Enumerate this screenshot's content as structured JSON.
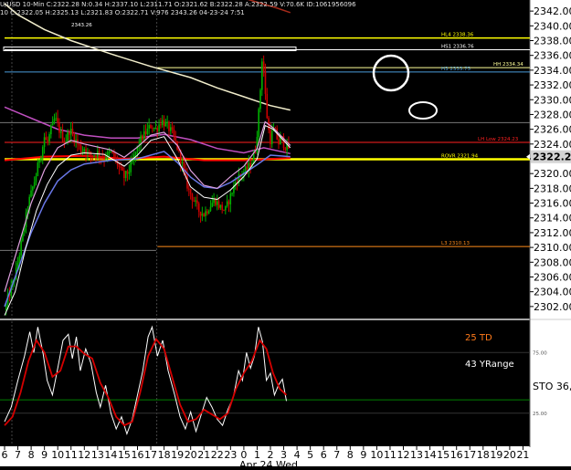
{
  "header": {
    "line1": "U/USD 10-Min  C:2322.28 N:0.34 H:2337.10 L:2311.71 O:2321.62 B:2322.28 A:2322.59 V:70.6K  ID:1061956096",
    "line2": "10 C:2322.05 H:2325.13 L:2321.83 O:2322.71 V:976 2343.26 04-23-24 7:51"
  },
  "colors": {
    "background": "#000000",
    "axis_panel": "#ffffff",
    "price_box": "#d4d4d4",
    "up_candle": "#00b000",
    "down_candle": "#cc0000",
    "bright_yellow": "#ffff00",
    "red": "#ff0000",
    "cream_ma": "#f2eecc",
    "sto_white": "#ffffff",
    "sto_red": "#d40000"
  },
  "chart_data": [
    {
      "type": "candlestick",
      "title": "",
      "ylim": [
        2300.5,
        2343.5
      ],
      "y_ticks": [
        "2302.00",
        "2304.00",
        "2306.00",
        "2308.00",
        "2310.00",
        "2312.00",
        "2314.00",
        "2316.00",
        "2318.00",
        "2320.00",
        "2322.00",
        "2324.00",
        "2326.00",
        "2328.00",
        "2330.00",
        "2332.00",
        "2334.00",
        "2336.00",
        "2338.00",
        "2340.00",
        "2342.00"
      ],
      "last_price": "2322.28",
      "high_label": "2343.26",
      "levels": [
        {
          "label": "HL4 2338.36",
          "value": 2338.36,
          "color": "#ffff00"
        },
        {
          "label": "HS1 2336.76",
          "value": 2336.76,
          "color": "#ffffff"
        },
        {
          "label": "HH 2334.34",
          "value": 2334.34,
          "color": "#ffff99"
        },
        {
          "label": "H3 2333.75",
          "value": 2333.75,
          "color": "#4a9bd8"
        },
        {
          "label": "LH Low 2324.23",
          "value": 2324.23,
          "color": "#ff2020"
        },
        {
          "label": "ROVR 2321.94",
          "value": 2321.94,
          "color": "#ffff00"
        },
        {
          "label": "L3 2310.13",
          "value": 2310.13,
          "color": "#ff8c1a"
        }
      ],
      "price_path": [
        [
          0,
          2301.5
        ],
        [
          0.1,
          2302
        ],
        [
          0.3,
          2303.5
        ],
        [
          0.6,
          2305
        ],
        [
          0.9,
          2307
        ],
        [
          1.2,
          2310
        ],
        [
          1.5,
          2313
        ],
        [
          1.8,
          2316
        ],
        [
          2.1,
          2318
        ],
        [
          2.4,
          2320
        ],
        [
          2.6,
          2322
        ],
        [
          2.8,
          2323
        ],
        [
          3.0,
          2325
        ],
        [
          3.2,
          2324
        ],
        [
          3.5,
          2326
        ],
        [
          3.8,
          2327.5
        ],
        [
          4.0,
          2326.5
        ],
        [
          4.3,
          2325
        ],
        [
          4.6,
          2324.5
        ],
        [
          4.9,
          2326
        ],
        [
          5.2,
          2325
        ],
        [
          5.5,
          2324
        ],
        [
          5.8,
          2323
        ],
        [
          6.0,
          2323.5
        ],
        [
          6.3,
          2322.5
        ],
        [
          6.6,
          2322.5
        ],
        [
          7.0,
          2322.8
        ],
        [
          7.4,
          2322.2
        ],
        [
          8.0,
          2322.8
        ],
        [
          8.3,
          2322
        ],
        [
          8.7,
          2320.5
        ],
        [
          9.0,
          2319.5
        ],
        [
          9.4,
          2320.5
        ],
        [
          9.8,
          2322.5
        ],
        [
          10.2,
          2324.5
        ],
        [
          10.6,
          2325.5
        ],
        [
          11.0,
          2326.5
        ],
        [
          11.4,
          2326
        ],
        [
          11.8,
          2327.2
        ],
        [
          12.2,
          2326.5
        ],
        [
          12.6,
          2325.5
        ],
        [
          13.0,
          2323.5
        ],
        [
          13.4,
          2321
        ],
        [
          13.8,
          2318
        ],
        [
          14.2,
          2316.5
        ],
        [
          14.6,
          2315
        ],
        [
          15.0,
          2314.5
        ],
        [
          15.4,
          2315.5
        ],
        [
          15.8,
          2316.5
        ],
        [
          16.2,
          2315.5
        ],
        [
          16.6,
          2315
        ],
        [
          17.0,
          2317
        ],
        [
          17.4,
          2319
        ],
        [
          17.8,
          2320
        ],
        [
          18.2,
          2320.5
        ],
        [
          18.6,
          2321.5
        ],
        [
          18.9,
          2323.5
        ],
        [
          19.2,
          2330
        ],
        [
          19.4,
          2336.5
        ],
        [
          19.6,
          2331
        ],
        [
          19.8,
          2326.5
        ],
        [
          20.0,
          2324.5
        ],
        [
          20.2,
          2326
        ],
        [
          20.4,
          2325.5
        ],
        [
          20.6,
          2324
        ],
        [
          20.8,
          2325
        ],
        [
          21.0,
          2324
        ],
        [
          21.2,
          2323.5
        ],
        [
          21.4,
          2323.5
        ]
      ]
    },
    {
      "type": "line",
      "title": "",
      "ylim": [
        0,
        100
      ],
      "labels": {
        "td": "25 TD",
        "yrange": "43 YRange",
        "sto": "STO  36,",
        "t75": "75.00",
        "t25": "25.00"
      },
      "series": [
        {
          "color": "#ffffff",
          "points": [
            [
              0,
              18
            ],
            [
              0.5,
              30
            ],
            [
              1.0,
              52
            ],
            [
              1.5,
              72
            ],
            [
              1.9,
              92
            ],
            [
              2.2,
              75
            ],
            [
              2.5,
              96
            ],
            [
              2.9,
              74
            ],
            [
              3.2,
              52
            ],
            [
              3.6,
              40
            ],
            [
              4.0,
              62
            ],
            [
              4.4,
              85
            ],
            [
              4.8,
              90
            ],
            [
              5.1,
              70
            ],
            [
              5.4,
              88
            ],
            [
              5.7,
              60
            ],
            [
              6.1,
              78
            ],
            [
              6.5,
              66
            ],
            [
              6.9,
              42
            ],
            [
              7.2,
              30
            ],
            [
              7.6,
              48
            ],
            [
              8.0,
              25
            ],
            [
              8.4,
              12
            ],
            [
              8.8,
              22
            ],
            [
              9.2,
              8
            ],
            [
              9.6,
              20
            ],
            [
              10.0,
              40
            ],
            [
              10.4,
              60
            ],
            [
              10.8,
              88
            ],
            [
              11.1,
              96
            ],
            [
              11.5,
              72
            ],
            [
              11.9,
              85
            ],
            [
              12.3,
              60
            ],
            [
              12.8,
              40
            ],
            [
              13.2,
              22
            ],
            [
              13.6,
              12
            ],
            [
              14.0,
              26
            ],
            [
              14.4,
              10
            ],
            [
              14.8,
              24
            ],
            [
              15.2,
              38
            ],
            [
              15.6,
              30
            ],
            [
              16.0,
              20
            ],
            [
              16.4,
              15
            ],
            [
              16.8,
              28
            ],
            [
              17.2,
              38
            ],
            [
              17.6,
              60
            ],
            [
              17.9,
              52
            ],
            [
              18.2,
              75
            ],
            [
              18.5,
              62
            ],
            [
              18.8,
              72
            ],
            [
              19.1,
              96
            ],
            [
              19.4,
              84
            ],
            [
              19.7,
              52
            ],
            [
              20.0,
              58
            ],
            [
              20.3,
              40
            ],
            [
              20.6,
              48
            ],
            [
              20.9,
              53
            ],
            [
              21.2,
              35
            ]
          ]
        },
        {
          "color": "#d40000",
          "points": [
            [
              0,
              15
            ],
            [
              0.6,
              22
            ],
            [
              1.2,
              42
            ],
            [
              1.8,
              68
            ],
            [
              2.4,
              85
            ],
            [
              3.0,
              75
            ],
            [
              3.6,
              55
            ],
            [
              4.2,
              60
            ],
            [
              4.8,
              80
            ],
            [
              5.4,
              80
            ],
            [
              6.0,
              74
            ],
            [
              6.6,
              70
            ],
            [
              7.2,
              50
            ],
            [
              7.8,
              38
            ],
            [
              8.4,
              22
            ],
            [
              9.0,
              15
            ],
            [
              9.6,
              18
            ],
            [
              10.2,
              42
            ],
            [
              10.8,
              72
            ],
            [
              11.4,
              86
            ],
            [
              12.0,
              78
            ],
            [
              12.6,
              55
            ],
            [
              13.2,
              32
            ],
            [
              13.8,
              18
            ],
            [
              14.4,
              20
            ],
            [
              15.0,
              28
            ],
            [
              15.6,
              24
            ],
            [
              16.2,
              20
            ],
            [
              16.8,
              25
            ],
            [
              17.4,
              45
            ],
            [
              18.0,
              58
            ],
            [
              18.6,
              68
            ],
            [
              19.2,
              85
            ],
            [
              19.7,
              78
            ],
            [
              20.2,
              58
            ],
            [
              20.7,
              45
            ],
            [
              21.2,
              40
            ]
          ]
        }
      ]
    },
    {
      "type": "axis",
      "x_ticks": [
        "6",
        "7",
        "8",
        "9",
        "10",
        "11",
        "12",
        "13",
        "14",
        "15",
        "16",
        "17",
        "18",
        "19",
        "20",
        "21",
        "22",
        "23",
        "0",
        "1",
        "2",
        "3",
        "4",
        "5",
        "6",
        "7",
        "8",
        "9",
        "10",
        "11",
        "12",
        "13",
        "14",
        "15",
        "16",
        "17",
        "18",
        "19",
        "20",
        "21"
      ],
      "date_label": "Apr 24 Wed"
    }
  ]
}
